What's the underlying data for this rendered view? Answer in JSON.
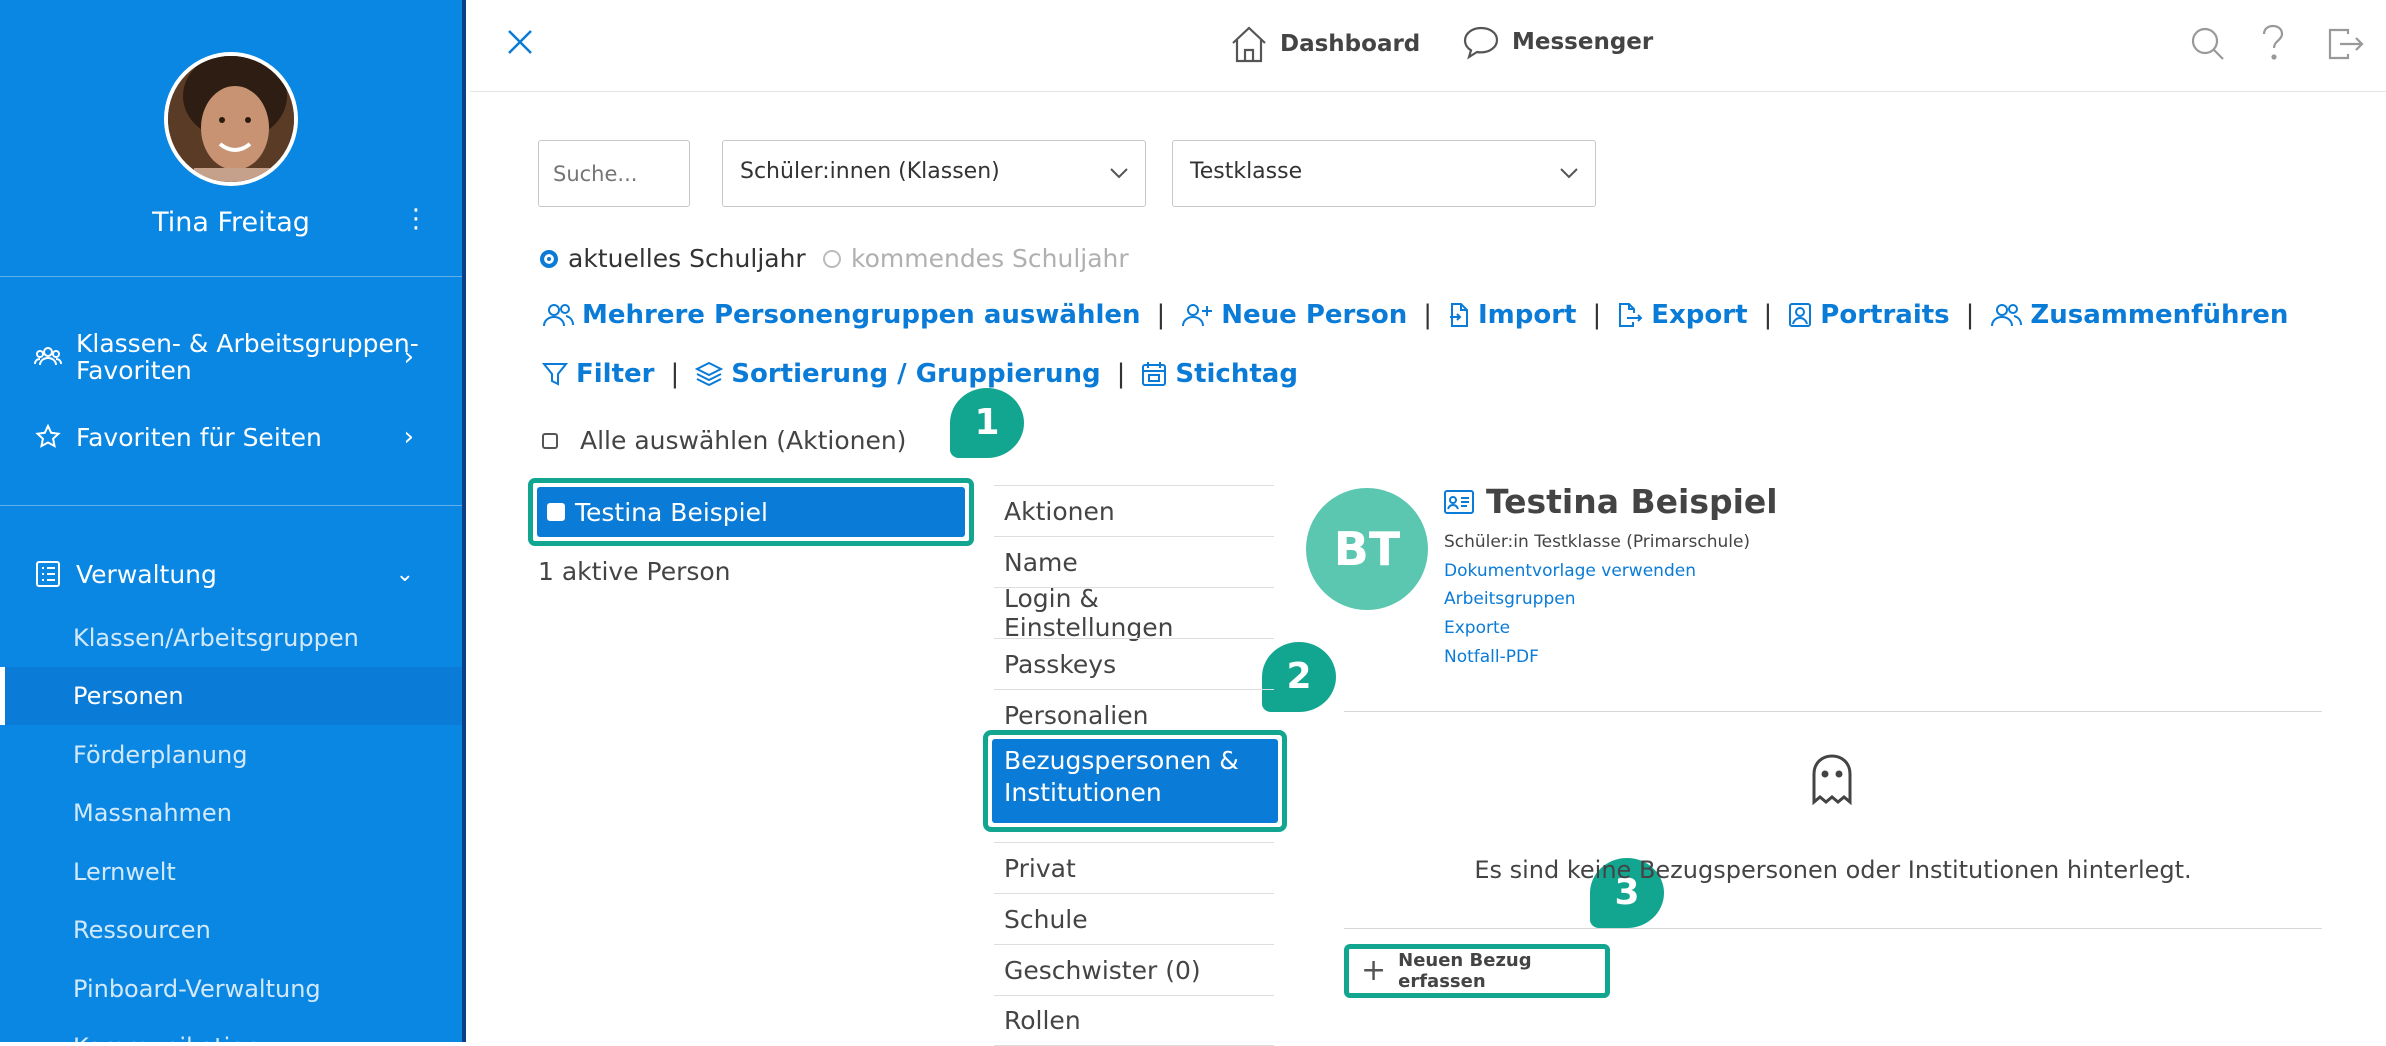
{
  "sidebar": {
    "user_name": "Tina Freitag",
    "user_menu_icon": "⋮",
    "favorites": [
      {
        "label": "Klassen- & Arbeitsgruppen-Favoriten",
        "icon": "group-icon"
      },
      {
        "label": "Favoriten für Seiten",
        "icon": "star-icon"
      }
    ],
    "section": {
      "label": "Verwaltung",
      "icon": "list-icon"
    },
    "items": [
      {
        "label": "Klassen/Arbeitsgruppen"
      },
      {
        "label": "Personen",
        "active": true
      },
      {
        "label": "Förderplanung"
      },
      {
        "label": "Massnahmen"
      },
      {
        "label": "Lernwelt"
      },
      {
        "label": "Ressourcen"
      },
      {
        "label": "Pinboard-Verwaltung"
      },
      {
        "label": "Kommunikation"
      }
    ]
  },
  "topbar": {
    "dashboard_label": "Dashboard",
    "messenger_label": "Messenger"
  },
  "filters": {
    "search_placeholder": "Suche...",
    "group_type": "Schüler:innen (Klassen)",
    "class": "Testklasse",
    "year_current": "aktuelles Schuljahr",
    "year_next": "kommendes Schuljahr"
  },
  "actions": {
    "multi_groups": "Mehrere Personengruppen auswählen",
    "new_person": "Neue Person",
    "import": "Import",
    "export": "Export",
    "portraits": "Portraits",
    "merge": "Zusammenführen",
    "filter": "Filter",
    "sort": "Sortierung / Gruppierung",
    "key_date": "Stichtag",
    "select_all": "Alle auswählen (Aktionen)"
  },
  "person_list": {
    "selected": "Testina Beispiel",
    "count_text": "1 aktive Person"
  },
  "tabs": [
    "Aktionen",
    "Name",
    "Login & Einstellungen",
    "Passkeys",
    "Personalien",
    "Bezugspersonen & Institutionen",
    "Privat",
    "Schule",
    "Geschwister (0)",
    "Rollen"
  ],
  "profile": {
    "initials": "BT",
    "name": "Testina Beispiel",
    "role": "Schüler:in Testklasse (Primarschule)",
    "links": [
      "Dokumentvorlage verwenden",
      "Arbeitsgruppen",
      "Exporte",
      "Notfall-PDF"
    ],
    "empty_message": "Es sind keine Bezugspersonen oder Institutionen hinterlegt.",
    "add_button": "Neuen Bezug erfassen"
  },
  "callouts": [
    "1",
    "2",
    "3"
  ],
  "colors": {
    "sidebar": "#0a86e3",
    "accent": "#0a7bd6",
    "highlight": "#12a690",
    "avatar_bg": "#5bc7b0"
  }
}
